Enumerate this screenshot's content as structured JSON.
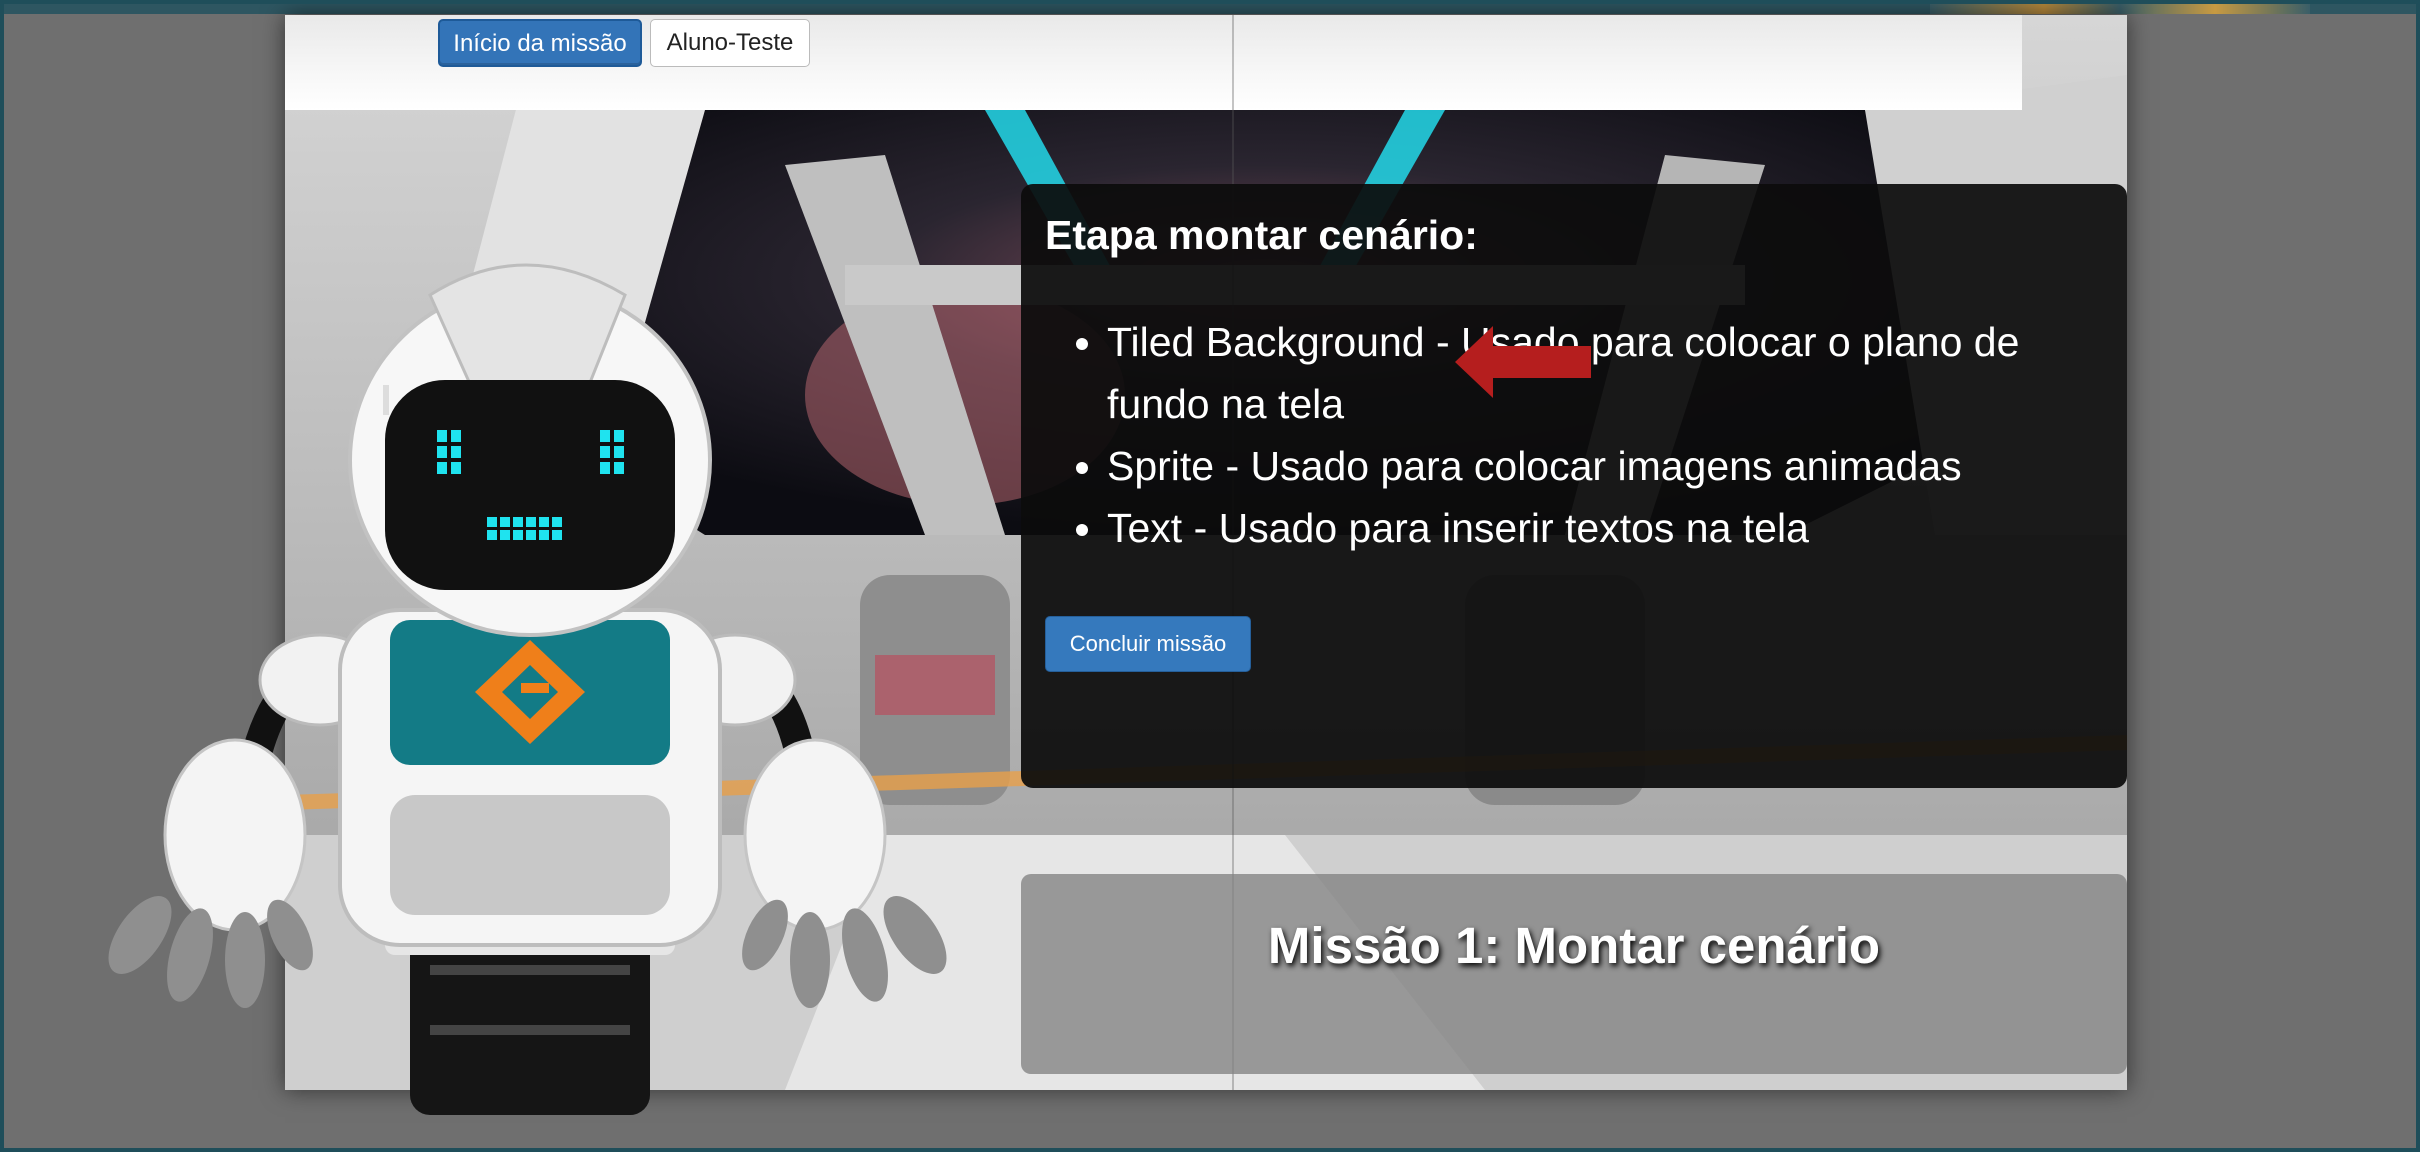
{
  "header": {
    "start_mission_label": "Início da missão",
    "user_label": "Aluno-Teste"
  },
  "panel": {
    "title": "Etapa montar cenário:",
    "items": [
      "Tiled Background - Usado para colocar o plano de fundo na tela",
      "Sprite - Usado para colocar imagens animadas",
      "Text - Usado para inserir textos na tela"
    ],
    "finish_label": "Concluir missão"
  },
  "mission": {
    "title": "Missão 1: Montar cenário"
  },
  "icons": {
    "pointer": "red-arrow-icon",
    "robot": "robot-mascot",
    "badge": "orange-diamond-logo-icon"
  },
  "colors": {
    "button_blue": "#3374b8",
    "arrow_red": "#b51e1e",
    "robot_teal": "#127a85",
    "eye_cyan": "#1fe3ef",
    "badge_orange": "#ef7f1a"
  }
}
